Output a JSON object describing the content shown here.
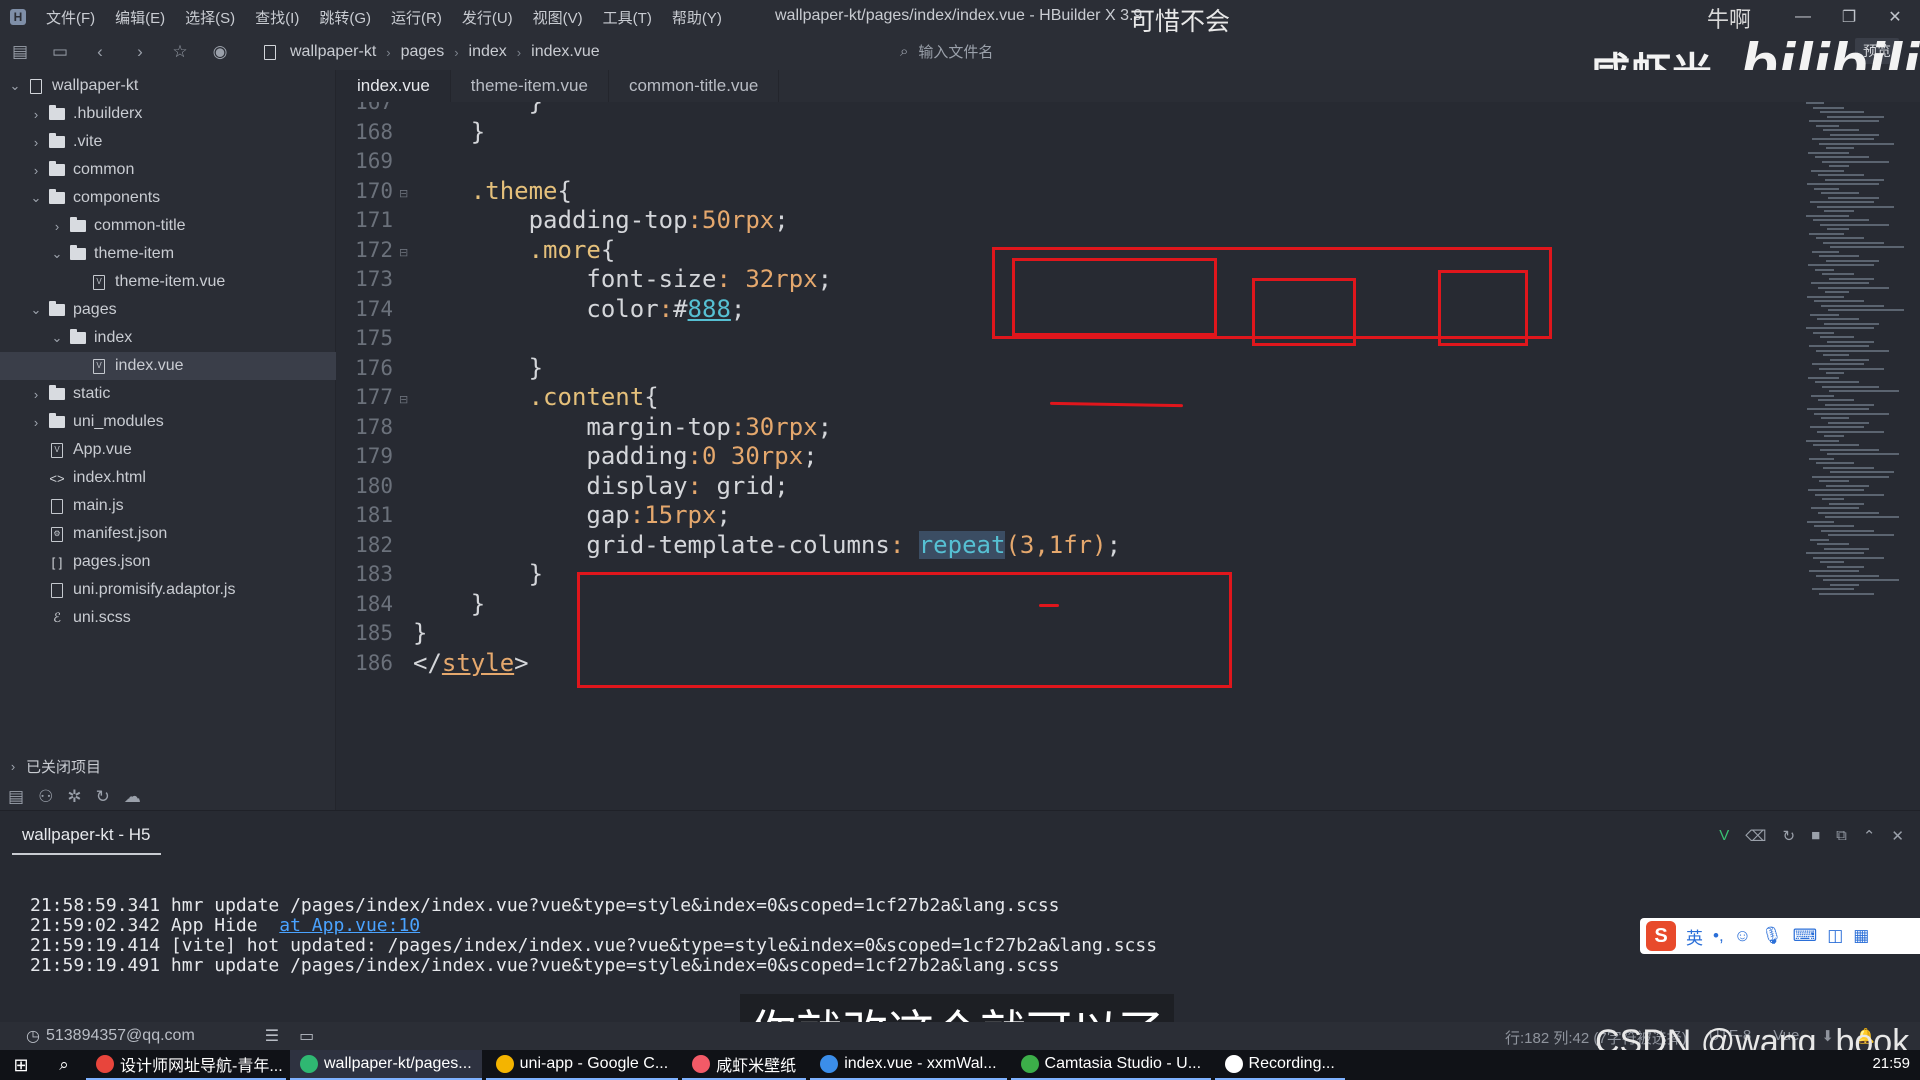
{
  "titlebar": {
    "menus": [
      "文件(F)",
      "编辑(E)",
      "选择(S)",
      "查找(I)",
      "跳转(G)",
      "运行(R)",
      "发行(U)",
      "视图(V)",
      "工具(T)",
      "帮助(Y)"
    ],
    "window_title": "wallpaper-kt/pages/index/index.vue - HBuilder X 3.9",
    "overlay_text": "可惜不会",
    "overlay_text_right": "牛啊"
  },
  "toolbar": {
    "breadcrumb": [
      "wallpaper-kt",
      "pages",
      "index",
      "index.vue"
    ],
    "file_search_placeholder": "输入文件名",
    "preview_label": "预览",
    "watermark_text": "咸虾米_",
    "watermark_brand": "bilibili"
  },
  "sidebar": {
    "items": [
      {
        "label": "wallpaper-kt",
        "depth": 0,
        "kind": "project",
        "expanded": true
      },
      {
        "label": ".hbuilderx",
        "depth": 1,
        "kind": "folder",
        "expanded": false
      },
      {
        "label": ".vite",
        "depth": 1,
        "kind": "folder",
        "expanded": false
      },
      {
        "label": "common",
        "depth": 1,
        "kind": "folder",
        "expanded": false
      },
      {
        "label": "components",
        "depth": 1,
        "kind": "folder",
        "expanded": true
      },
      {
        "label": "common-title",
        "depth": 2,
        "kind": "folder",
        "expanded": false
      },
      {
        "label": "theme-item",
        "depth": 2,
        "kind": "folder",
        "expanded": true
      },
      {
        "label": "theme-item.vue",
        "depth": 3,
        "kind": "vue"
      },
      {
        "label": "pages",
        "depth": 1,
        "kind": "folder",
        "expanded": true
      },
      {
        "label": "index",
        "depth": 2,
        "kind": "folder",
        "expanded": true
      },
      {
        "label": "index.vue",
        "depth": 3,
        "kind": "vue",
        "selected": true
      },
      {
        "label": "static",
        "depth": 1,
        "kind": "folder",
        "expanded": false
      },
      {
        "label": "uni_modules",
        "depth": 1,
        "kind": "folder",
        "expanded": false
      },
      {
        "label": "App.vue",
        "depth": 1,
        "kind": "vue"
      },
      {
        "label": "index.html",
        "depth": 1,
        "kind": "html"
      },
      {
        "label": "main.js",
        "depth": 1,
        "kind": "js"
      },
      {
        "label": "manifest.json",
        "depth": 1,
        "kind": "manifest"
      },
      {
        "label": "pages.json",
        "depth": 1,
        "kind": "json"
      },
      {
        "label": "uni.promisify.adaptor.js",
        "depth": 1,
        "kind": "js"
      },
      {
        "label": "uni.scss",
        "depth": 1,
        "kind": "scss"
      }
    ],
    "closed_projects_label": "已关闭项目"
  },
  "tabs": [
    "index.vue",
    "theme-item.vue",
    "common-title.vue"
  ],
  "editor": {
    "lines": [
      {
        "n": "167",
        "code": "        }"
      },
      {
        "n": "168",
        "code": "    }"
      },
      {
        "n": "169",
        "code": ""
      },
      {
        "n": "170",
        "code": "    .theme{",
        "fold": true
      },
      {
        "n": "171",
        "code": "        padding-top:50rpx;"
      },
      {
        "n": "172",
        "code": "        .more{",
        "fold": true
      },
      {
        "n": "173",
        "code": "            font-size: 32rpx;"
      },
      {
        "n": "174",
        "code": "            color:#888;"
      },
      {
        "n": "175",
        "code": ""
      },
      {
        "n": "176",
        "code": "        }"
      },
      {
        "n": "177",
        "code": "        .content{",
        "fold": true
      },
      {
        "n": "178",
        "code": "            margin-top:30rpx;"
      },
      {
        "n": "179",
        "code": "            padding:0 30rpx;"
      },
      {
        "n": "180",
        "code": "            display: grid;"
      },
      {
        "n": "181",
        "code": "            gap:15rpx;"
      },
      {
        "n": "182",
        "code": "            grid-template-columns: repeat(3,1fr);"
      },
      {
        "n": "183",
        "code": "        }"
      },
      {
        "n": "184",
        "code": "    }"
      },
      {
        "n": "185",
        "code": "}"
      },
      {
        "n": "186",
        "code": "</style>"
      }
    ]
  },
  "console": {
    "tab_label": "wallpaper-kt - H5",
    "logs": [
      {
        "time": "21:58:59.341",
        "text": "hmr update /pages/index/index.vue?vue&type=style&index=0&scoped=1cf27b2a&lang.scss"
      },
      {
        "time": "21:59:02.342",
        "text": "App Hide  ",
        "link": "at App.vue:10"
      },
      {
        "time": "21:59:19.414",
        "text": "[vite] hot updated: /pages/index/index.vue?vue&type=style&index=0&scoped=1cf27b2a&lang.scss"
      },
      {
        "time": "21:59:19.491",
        "text": "hmr update /pages/index/index.vue?vue&type=style&index=0&scoped=1cf27b2a&lang.scss"
      }
    ],
    "subtitle": "你就改这个就可以了",
    "ime_lang": "英"
  },
  "statusbar": {
    "user": "513894357@qq.com",
    "position": "行:182  列:42 (7字符被选择)",
    "encoding": "UTF-8",
    "language": "Vue"
  },
  "taskbar": {
    "items": [
      {
        "label": "设计师网址导航-青年...",
        "color": "#e8453c"
      },
      {
        "label": "wallpaper-kt/pages...",
        "color": "#2fb872",
        "active": true
      },
      {
        "label": "uni-app - Google C...",
        "color": "#f4b400"
      },
      {
        "label": "咸虾米壁纸",
        "color": "#f25a67"
      },
      {
        "label": "index.vue - xxmWal...",
        "color": "#3b8eea"
      },
      {
        "label": "Camtasia Studio - U...",
        "color": "#3cae49"
      },
      {
        "label": "Recording...",
        "color": "#ffffff"
      }
    ],
    "csdn_watermark": "CSDN @wang_book",
    "clock": "21:59"
  },
  "colors": {
    "annotation_red": "#e0161c",
    "accent_blue": "#4aa3ff"
  }
}
